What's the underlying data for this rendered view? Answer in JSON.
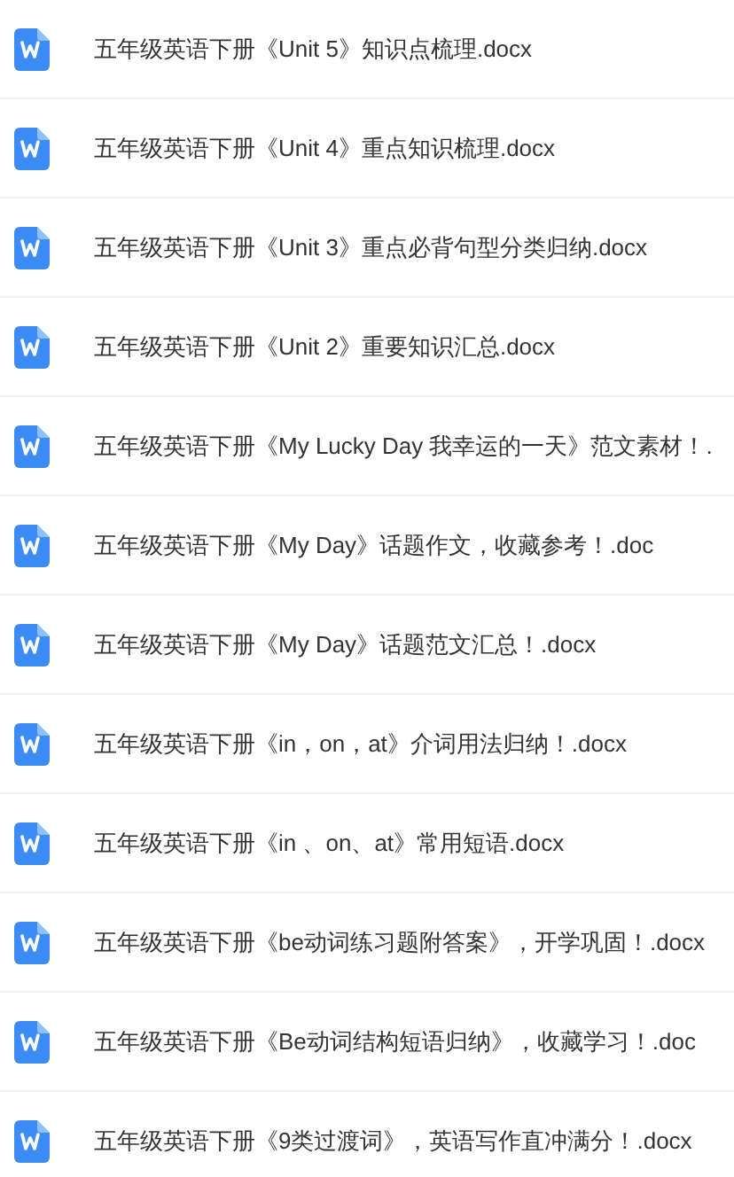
{
  "files": [
    {
      "name": "五年级英语下册《Unit 5》知识点梳理.docx",
      "kind": "word"
    },
    {
      "name": "五年级英语下册《Unit 4》重点知识梳理.docx",
      "kind": "word"
    },
    {
      "name": "五年级英语下册《Unit 3》重点必背句型分类归纳.docx",
      "kind": "word"
    },
    {
      "name": "五年级英语下册《Unit 2》重要知识汇总.docx",
      "kind": "word"
    },
    {
      "name": "五年级英语下册《My Lucky Day 我幸运的一天》范文素材！.",
      "kind": "word"
    },
    {
      "name": "五年级英语下册《My Day》话题作文，收藏参考！.doc",
      "kind": "word"
    },
    {
      "name": "五年级英语下册《My Day》话题范文汇总！.docx",
      "kind": "word"
    },
    {
      "name": "五年级英语下册《in，on，at》介词用法归纳！.docx",
      "kind": "word"
    },
    {
      "name": "五年级英语下册《in 、on、at》常用短语.docx",
      "kind": "word"
    },
    {
      "name": "五年级英语下册《be动词练习题附答案》，开学巩固！.docx",
      "kind": "word"
    },
    {
      "name": "五年级英语下册《Be动词结构短语归纳》，收藏学习！.doc",
      "kind": "word"
    },
    {
      "name": "五年级英语下册《9类过渡词》，英语写作直冲满分！.docx",
      "kind": "word"
    }
  ]
}
